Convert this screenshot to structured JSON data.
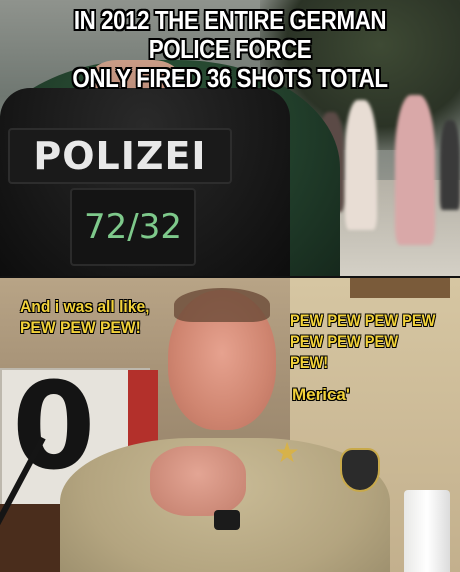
{
  "top_panel": {
    "caption_line1": "IN 2012 THE ENTIRE GERMAN POLICE FORCE",
    "caption_line2": "ONLY FIRED 36 SHOTS TOTAL",
    "patch_text": "POLIZEI",
    "patch_number": "72/32"
  },
  "bottom_panel": {
    "caption_left": "And i was all like,\nPEW PEW PEW!",
    "caption_right": "PEW PEW PEW PEW\nPEW PEW PEW PEW!",
    "caption_merica": "Merica'",
    "background_digit": "0"
  },
  "colors": {
    "caption_white": "#ffffff",
    "caption_yellow": "#f2d23a",
    "patch_number_green": "#7ec98b"
  }
}
